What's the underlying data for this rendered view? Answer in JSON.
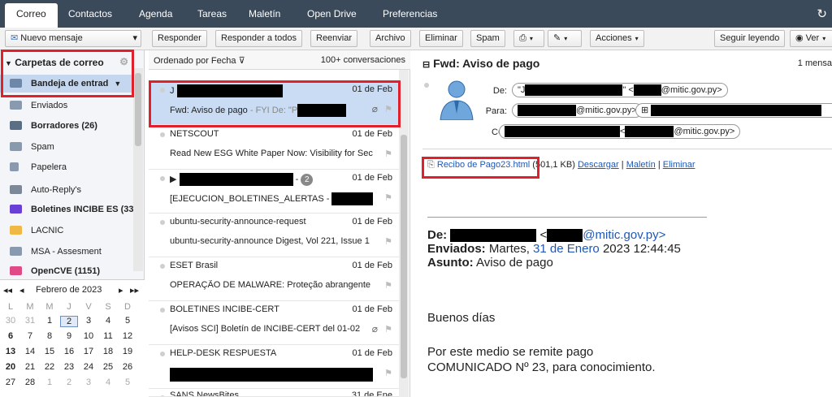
{
  "top_tabs": [
    "Correo",
    "Contactos",
    "Agenda",
    "Tareas",
    "Maletín",
    "Open Drive",
    "Preferencias"
  ],
  "toolbar": {
    "new_message": "Nuevo mensaje",
    "reply": "Responder",
    "reply_all": "Responder a todos",
    "forward": "Reenviar",
    "archive": "Archivo",
    "delete": "Eliminar",
    "spam": "Spam",
    "actions": "Acciones",
    "keep_reading": "Seguir leyendo",
    "view": "Ver"
  },
  "folders": {
    "header": "Carpetas de correo",
    "items": [
      {
        "label": "Bandeja de entrad",
        "icon": "inbox-icon"
      },
      {
        "label": "Enviados",
        "icon": "sent-icon"
      },
      {
        "label": "Borradores (26)",
        "icon": "drafts-icon"
      },
      {
        "label": "Spam",
        "icon": "spam-icon"
      },
      {
        "label": "Papelera",
        "icon": "trash-icon"
      },
      {
        "label": "Auto-Reply's",
        "icon": "folder-icon"
      },
      {
        "label": "Boletines INCIBE ES (33",
        "icon": "folder-icon"
      },
      {
        "label": "LACNIC",
        "icon": "folder-icon"
      },
      {
        "label": "MSA - Assesment",
        "icon": "folder-icon"
      },
      {
        "label": "OpenCVE (1151)",
        "icon": "folder-icon"
      }
    ]
  },
  "calendar": {
    "month": "Febrero de 2023",
    "prev_year": "◂◂",
    "prev_month": "◂",
    "next_month": "▸",
    "next_year": "▸▸",
    "weekdays": [
      "L",
      "M",
      "M",
      "J",
      "V",
      "S",
      "D"
    ],
    "weeks": [
      [
        "30",
        "31",
        "1",
        "2",
        "3",
        "4",
        "5"
      ],
      [
        "6",
        "7",
        "8",
        "9",
        "10",
        "11",
        "12"
      ],
      [
        "13",
        "14",
        "15",
        "16",
        "17",
        "18",
        "19"
      ],
      [
        "20",
        "21",
        "22",
        "23",
        "24",
        "25",
        "26"
      ],
      [
        "27",
        "28",
        "1",
        "2",
        "3",
        "4",
        "5"
      ]
    ]
  },
  "message_list": {
    "sort_label": "Ordenado por Fecha",
    "count": "100+ conversaciones",
    "messages": [
      {
        "from": "J",
        "date": "01 de Feb",
        "subject": "Fwd: Aviso de pago",
        "preview": " - FYI De: \"P"
      },
      {
        "from": "NETSCOUT",
        "date": "01 de Feb",
        "subject": "Read New ESG White Paper Now: Visibility for Sec",
        "preview": ""
      },
      {
        "from": "",
        "date": "01 de Feb",
        "subject": "[EJECUCION_BOLETINES_ALERTAS - ",
        "preview": "",
        "thread_count": "2"
      },
      {
        "from": "ubuntu-security-announce-request",
        "date": "01 de Feb",
        "subject": "ubuntu-security-announce Digest, Vol 221, Issue 1",
        "preview": ""
      },
      {
        "from": "ESET Brasil",
        "date": "01 de Feb",
        "subject": "OPERAÇÃO DE MALWARE: Proteção abrangente co",
        "preview": ""
      },
      {
        "from": "BOLETINES INCIBE-CERT",
        "date": "01 de Feb",
        "subject": "[Avisos SCI] Boletín de INCIBE-CERT del 01-02",
        "preview": ""
      },
      {
        "from": "HELP-DESK RESPUESTA",
        "date": "01 de Feb",
        "subject": "",
        "preview": ""
      },
      {
        "from": "SANS NewsBites",
        "date": "31 de Ene",
        "subject": "",
        "preview": ""
      }
    ]
  },
  "reader": {
    "title": "Fwd: Aviso de pago",
    "count": "1 mensa",
    "de_label": "De:",
    "para_label": "Para:",
    "cc_label": "CC:",
    "de_value": "\"J",
    "de_email": "@mitic.gov.py>",
    "para_email": "@mitic.gov.py>",
    "cc_email": "@mitic.gov.py>",
    "attachment_name": "Recibo de Pago23.html",
    "attachment_size": "(501,1 KB)",
    "download": "Descargar",
    "briefcase": "Maletín",
    "remove": "Eliminar",
    "body_de_label": "De:",
    "body_de_email": "@mitic.gov.py>",
    "body_sent_label": "Enviados:",
    "body_sent_day": "Martes,",
    "body_sent_date": "31 de Enero",
    "body_sent_time": "2023 12:44:45",
    "body_subject_label": "Asunto:",
    "body_subject": "Aviso de pago",
    "greeting": "Buenos días",
    "line1": "Por este medio se remite pago",
    "line2": "COMUNICADO Nº 23, para conocimiento."
  }
}
